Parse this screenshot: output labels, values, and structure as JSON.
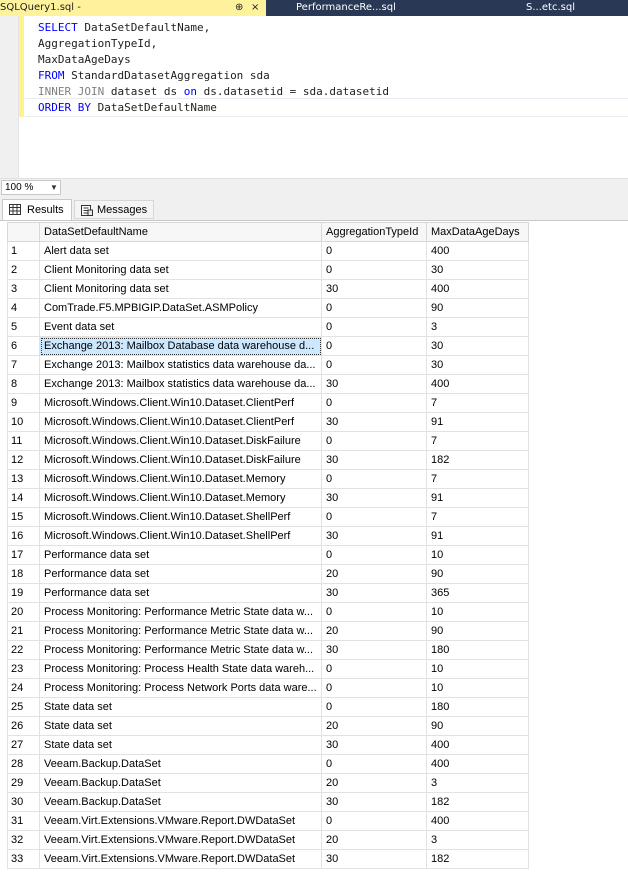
{
  "tabs": {
    "active_label": "SQLQuery1.sql - ",
    "pin_glyph": "⊕",
    "close_glyph": "×",
    "tab2_label": "PerformanceRe...sql",
    "tab3_label": "S...etc.sql"
  },
  "editor": {
    "lines": [
      {
        "kw": "SELECT",
        "rest": " DataSetDefaultName,"
      },
      {
        "kw": "",
        "rest": "AggregationTypeId,"
      },
      {
        "kw": "",
        "rest": "MaxDataAgeDays"
      },
      {
        "kw": "FROM",
        "rest": " StandardDatasetAggregation sda"
      },
      {
        "kw": "INNER JOIN",
        "rest": " dataset ds ",
        "kw2": "on",
        "rest2": " ds.datasetid = sda.datasetid"
      },
      {
        "kw": "ORDER BY",
        "rest": " DataSetDefaultName"
      }
    ]
  },
  "zoom": {
    "value": "100 %"
  },
  "results_tabs": {
    "results": "Results",
    "messages": "Messages"
  },
  "grid": {
    "columns": [
      "DataSetDefaultName",
      "AggregationTypeId",
      "MaxDataAgeDays"
    ],
    "selected_row": 6,
    "rows": [
      [
        "1",
        "Alert data set",
        "0",
        "400"
      ],
      [
        "2",
        "Client Monitoring data set",
        "0",
        "30"
      ],
      [
        "3",
        "Client Monitoring data set",
        "30",
        "400"
      ],
      [
        "4",
        "ComTrade.F5.MPBIGIP.DataSet.ASMPolicy",
        "0",
        "90"
      ],
      [
        "5",
        "Event data set",
        "0",
        "3"
      ],
      [
        "6",
        "Exchange 2013: Mailbox Database data warehouse d...",
        "0",
        "30"
      ],
      [
        "7",
        "Exchange 2013: Mailbox statistics data warehouse da...",
        "0",
        "30"
      ],
      [
        "8",
        "Exchange 2013: Mailbox statistics data warehouse da...",
        "30",
        "400"
      ],
      [
        "9",
        "Microsoft.Windows.Client.Win10.Dataset.ClientPerf",
        "0",
        "7"
      ],
      [
        "10",
        "Microsoft.Windows.Client.Win10.Dataset.ClientPerf",
        "30",
        "91"
      ],
      [
        "11",
        "Microsoft.Windows.Client.Win10.Dataset.DiskFailure",
        "0",
        "7"
      ],
      [
        "12",
        "Microsoft.Windows.Client.Win10.Dataset.DiskFailure",
        "30",
        "182"
      ],
      [
        "13",
        "Microsoft.Windows.Client.Win10.Dataset.Memory",
        "0",
        "7"
      ],
      [
        "14",
        "Microsoft.Windows.Client.Win10.Dataset.Memory",
        "30",
        "91"
      ],
      [
        "15",
        "Microsoft.Windows.Client.Win10.Dataset.ShellPerf",
        "0",
        "7"
      ],
      [
        "16",
        "Microsoft.Windows.Client.Win10.Dataset.ShellPerf",
        "30",
        "91"
      ],
      [
        "17",
        "Performance data set",
        "0",
        "10"
      ],
      [
        "18",
        "Performance data set",
        "20",
        "90"
      ],
      [
        "19",
        "Performance data set",
        "30",
        "365"
      ],
      [
        "20",
        "Process Monitoring: Performance Metric  State data w...",
        "0",
        "10"
      ],
      [
        "21",
        "Process Monitoring: Performance Metric  State data w...",
        "20",
        "90"
      ],
      [
        "22",
        "Process Monitoring: Performance Metric  State data w...",
        "30",
        "180"
      ],
      [
        "23",
        "Process Monitoring: Process Health State data wareh...",
        "0",
        "10"
      ],
      [
        "24",
        "Process Monitoring: Process Network Ports data ware...",
        "0",
        "10"
      ],
      [
        "25",
        "State data set",
        "0",
        "180"
      ],
      [
        "26",
        "State data set",
        "20",
        "90"
      ],
      [
        "27",
        "State data set",
        "30",
        "400"
      ],
      [
        "28",
        "Veeam.Backup.DataSet",
        "0",
        "400"
      ],
      [
        "29",
        "Veeam.Backup.DataSet",
        "20",
        "3"
      ],
      [
        "30",
        "Veeam.Backup.DataSet",
        "30",
        "182"
      ],
      [
        "31",
        "Veeam.Virt.Extensions.VMware.Report.DWDataSet",
        "0",
        "400"
      ],
      [
        "32",
        "Veeam.Virt.Extensions.VMware.Report.DWDataSet",
        "20",
        "3"
      ],
      [
        "33",
        "Veeam.Virt.Extensions.VMware.Report.DWDataSet",
        "30",
        "182"
      ]
    ]
  }
}
